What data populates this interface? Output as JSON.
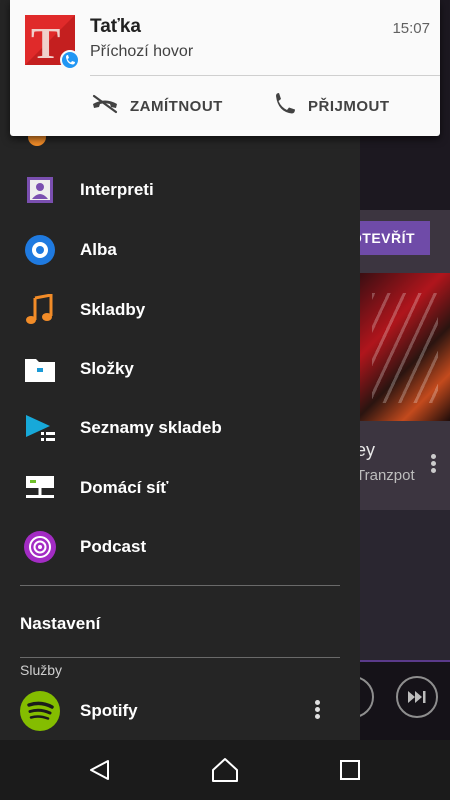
{
  "notification": {
    "caller": "Taťka",
    "time": "15:07",
    "subtitle": "Příchozí hovor",
    "decline_label": "ZAMÍTNOUT",
    "accept_label": "PŘIJMOUT",
    "avatar_letter": "T"
  },
  "drawer": {
    "items": [
      {
        "label": "Interpreti",
        "icon": "artist-icon"
      },
      {
        "label": "Alba",
        "icon": "album-icon"
      },
      {
        "label": "Skladby",
        "icon": "music-note-icon"
      },
      {
        "label": "Složky",
        "icon": "folder-icon"
      },
      {
        "label": "Seznamy skladeb",
        "icon": "playlist-icon"
      },
      {
        "label": "Domácí síť",
        "icon": "home-network-icon"
      },
      {
        "label": "Podcast",
        "icon": "podcast-icon"
      }
    ],
    "settings_label": "Nastavení",
    "services_label": "Služby",
    "spotify_label": "Spotify"
  },
  "background_app": {
    "open_button_label": "OTEVŘÍT",
    "track_title": "ey",
    "track_artist": "Tranzpot"
  },
  "colors": {
    "drawer_bg": "#252525",
    "accent_purple": "#6f4ba8",
    "spotify_green": "#1db954",
    "notification_bg": "#fafafa"
  }
}
